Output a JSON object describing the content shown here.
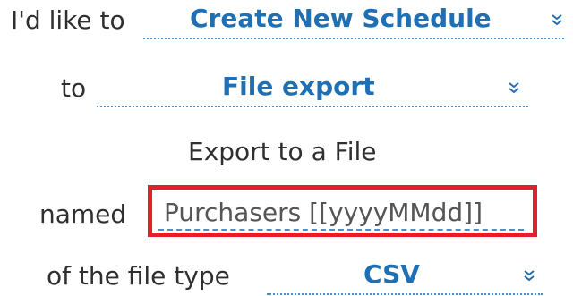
{
  "row1": {
    "label": "I'd like to",
    "select_value": "Create New Schedule",
    "chevron_icon": "chevron-double-down"
  },
  "row2": {
    "label": "to",
    "select_value": "File export",
    "chevron_icon": "chevron-double-down"
  },
  "section_title": "Export to a File",
  "row4": {
    "label": "named",
    "input_value": "Purchasers [[yyyyMMdd]]",
    "highlight_color": "#e0202d"
  },
  "row5": {
    "label": "of the file type",
    "select_value": "CSV",
    "chevron_icon": "chevron-double-down"
  },
  "colors": {
    "accent": "#1f6fb5",
    "text": "#2f2f2f",
    "underline": "#4a8fc8"
  }
}
